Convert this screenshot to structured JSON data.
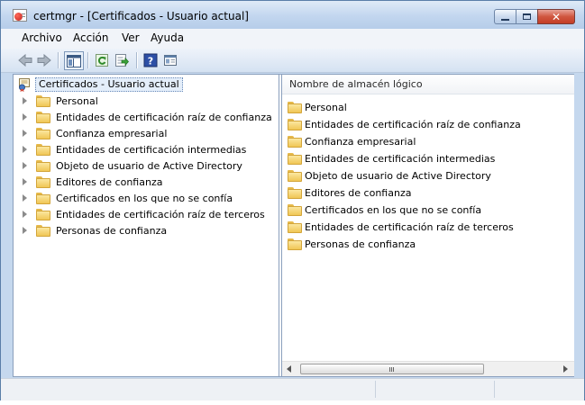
{
  "window": {
    "title": "certmgr - [Certificados - Usuario actual]",
    "close_label": "✕"
  },
  "menu": {
    "items": [
      "Archivo",
      "Acción",
      "Ver",
      "Ayuda"
    ]
  },
  "toolbar": {
    "buttons": [
      "back-icon",
      "forward-icon",
      "show-hide-tree-icon",
      "refresh-icon",
      "export-list-icon",
      "help-icon",
      "properties-icon"
    ]
  },
  "tree": {
    "root_label": "Certificados - Usuario actual",
    "items": [
      "Personal",
      "Entidades de certificación raíz de confianza",
      "Confianza empresarial",
      "Entidades de certificación intermedias",
      "Objeto de usuario de Active Directory",
      "Editores de confianza",
      "Certificados en los que no se confía",
      "Entidades de certificación raíz de terceros",
      "Personas de confianza"
    ]
  },
  "list": {
    "column_header": "Nombre de almacén lógico",
    "items": [
      "Personal",
      "Entidades de certificación raíz de confianza",
      "Confianza empresarial",
      "Entidades de certificación intermedias",
      "Objeto de usuario de Active Directory",
      "Editores de confianza",
      "Certificados en los que no se confía",
      "Entidades de certificación raíz de terceros",
      "Personas de confianza"
    ],
    "scroll_grip": "|||"
  },
  "colors": {
    "window_frame": "#c5d8ee",
    "close_button": "#c43d26",
    "folder": "#f0c655"
  }
}
